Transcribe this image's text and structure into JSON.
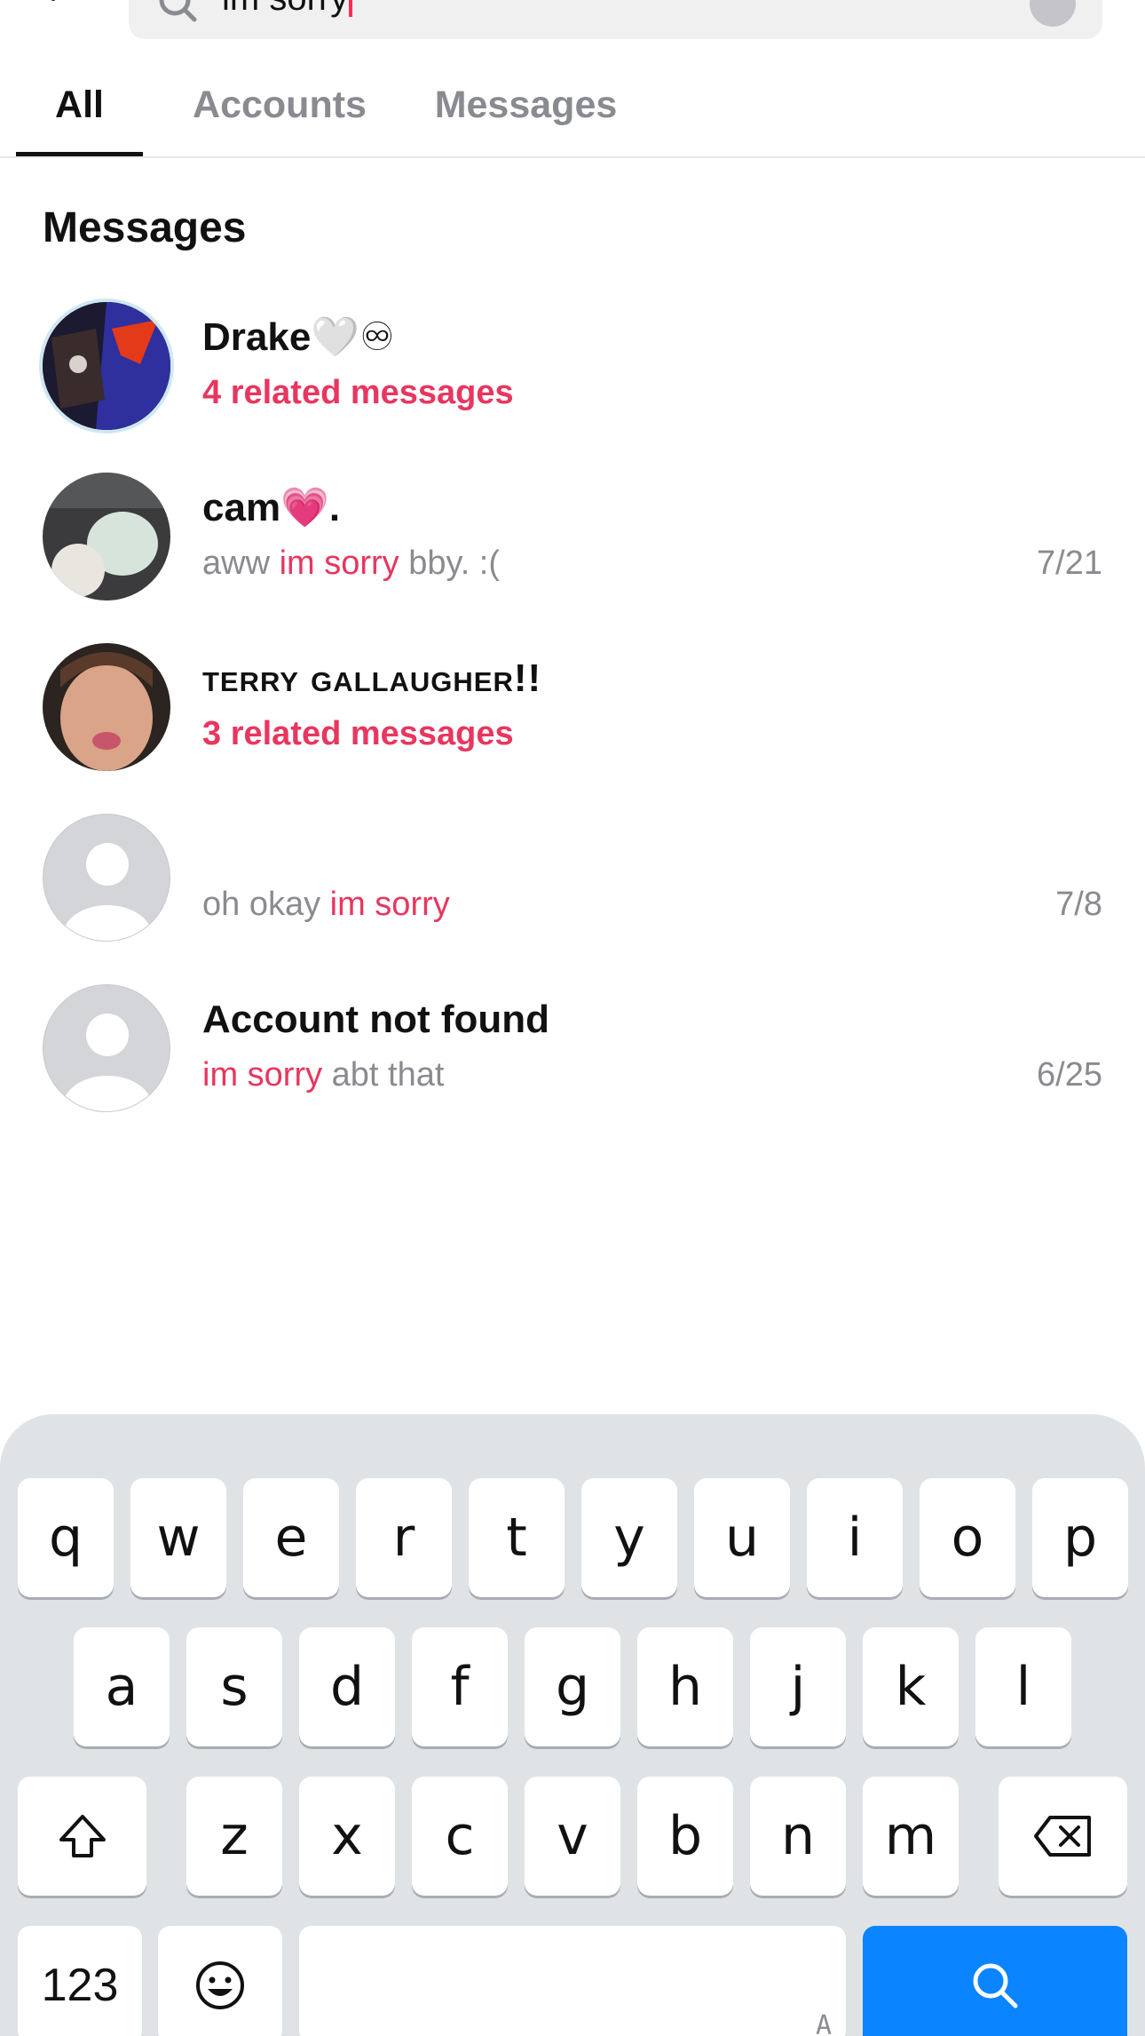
{
  "search": {
    "query": "im sorry"
  },
  "tabs": {
    "all": "All",
    "accounts": "Accounts",
    "messages": "Messages"
  },
  "section_title": "Messages",
  "results": [
    {
      "name": "Drake🤍♾",
      "sub": "4 related messages",
      "date": ""
    },
    {
      "name": "cam💗.",
      "sub_before": "aww ",
      "sub_match": "im sorry",
      "sub_after": " bby. :(",
      "date": "7/21"
    },
    {
      "name": "terry gallaugher!!",
      "sub": "3 related messages",
      "date": ""
    },
    {
      "name": "",
      "sub_before": "oh okay ",
      "sub_match": "im sorry",
      "sub_after": "",
      "date": "7/8"
    },
    {
      "name": "Account not found",
      "sub_before": "",
      "sub_match": "im sorry",
      "sub_after": " abt that",
      "date": "6/25"
    }
  ],
  "keyboard": {
    "row1": [
      "q",
      "w",
      "e",
      "r",
      "t",
      "y",
      "u",
      "i",
      "o",
      "p"
    ],
    "row2": [
      "a",
      "s",
      "d",
      "f",
      "g",
      "h",
      "j",
      "k",
      "l"
    ],
    "row3": [
      "z",
      "x",
      "c",
      "v",
      "b",
      "n",
      "m"
    ],
    "numbers_label": "123",
    "space_hint": "A",
    "icons": {
      "shift": "shift-icon",
      "delete": "delete-icon",
      "emoji": "emoji-icon",
      "search": "search-icon"
    }
  },
  "colors": {
    "accent": "#e8365f",
    "search_key": "#0a84ff",
    "keyboard_bg": "#e0e3e6"
  }
}
